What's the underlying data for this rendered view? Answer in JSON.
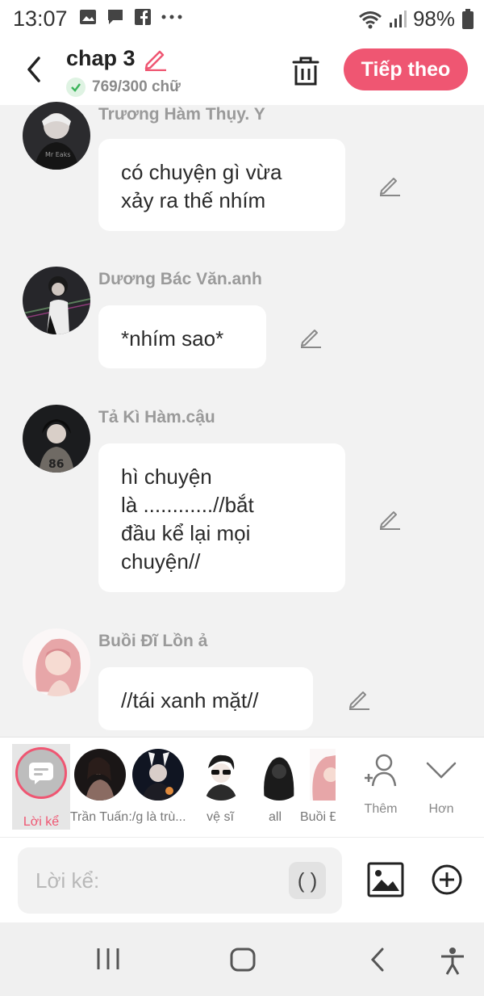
{
  "status": {
    "time": "13:07",
    "battery": "98%",
    "left_icons": [
      "gallery-icon",
      "message-icon",
      "facebook-icon",
      "more-dots-icon"
    ],
    "right_icons": [
      "wifi-icon",
      "signal-icon",
      "battery-icon"
    ]
  },
  "header": {
    "title": "chap 3",
    "word_count": "769/300 chữ",
    "next_label": "Tiếp theo",
    "accent": "#ef5672"
  },
  "messages": [
    {
      "sender": "Trương Hàm Thụy. Y",
      "text": "có chuyện gì vừa\nxảy ra thế nhím"
    },
    {
      "sender": "Dương Bác Văn.anh",
      "text": "*nhím sao*"
    },
    {
      "sender": "Tả Kì Hàm.cậu",
      "text": "hì chuyện\nlà ............//bắt\nđầu kể lại mọi\nchuyện//"
    },
    {
      "sender": "Buồi Đĩ Lồn ả",
      "text": "//tái xanh mặt//"
    }
  ],
  "charbar": {
    "narrator_label": "Lời kể",
    "characters": [
      {
        "label": "Trần Tuấn"
      },
      {
        "label": ":/g là trù..."
      },
      {
        "label": "vệ sĩ"
      },
      {
        "label": "all"
      },
      {
        "label": "Buồi Đ"
      }
    ],
    "add_label": "Thêm",
    "more_label": "Hơn"
  },
  "input": {
    "placeholder": "Lời kể:",
    "paren_label": "( )"
  },
  "navbar": {
    "icons": [
      "recent-apps-icon",
      "home-icon",
      "back-icon",
      "accessibility-icon"
    ]
  }
}
